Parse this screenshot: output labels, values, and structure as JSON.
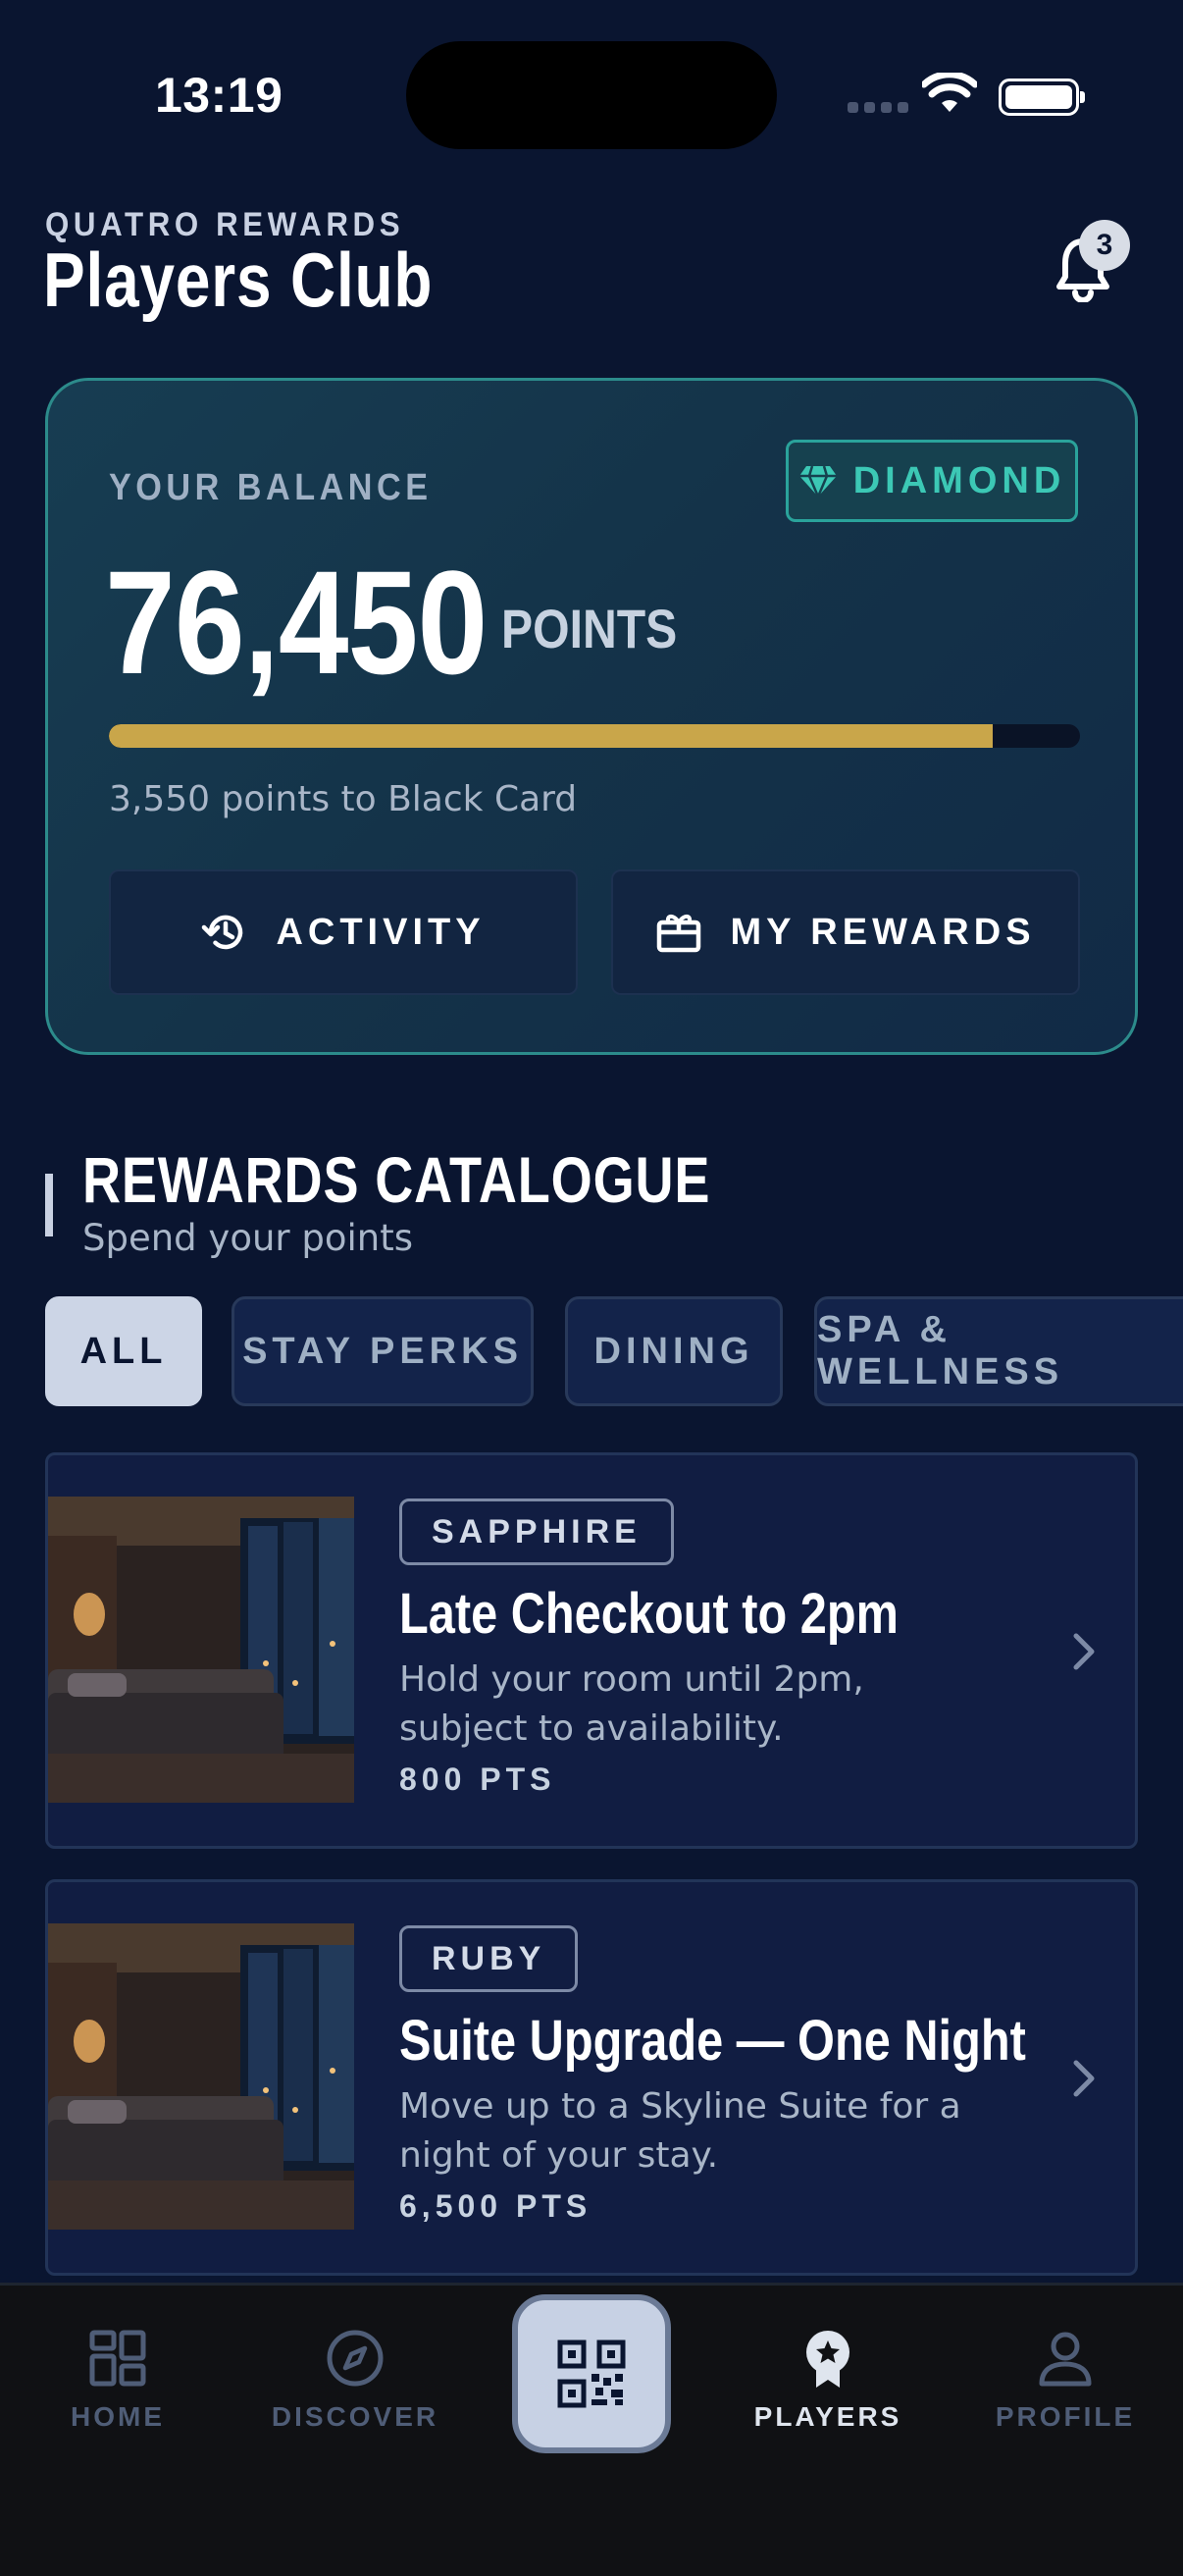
{
  "status_bar": {
    "time": "13:19"
  },
  "header": {
    "eyebrow": "QUATRO REWARDS",
    "title": "Players Club",
    "notification_count": "3"
  },
  "balance": {
    "label": "YOUR BALANCE",
    "tier": "DIAMOND",
    "points": "76,450",
    "points_unit": "POINTS",
    "progress_fraction": 0.91,
    "progress_text": "3,550 points to Black Card",
    "actions": [
      {
        "label": "ACTIVITY",
        "icon": "history-icon"
      },
      {
        "label": "MY REWARDS",
        "icon": "gift-card-icon"
      }
    ]
  },
  "catalogue": {
    "title": "REWARDS CATALOGUE",
    "subtitle": "Spend your points",
    "filters": [
      {
        "label": "ALL",
        "active": true
      },
      {
        "label": "STAY PERKS",
        "active": false
      },
      {
        "label": "DINING",
        "active": false
      },
      {
        "label": "SPA & WELLNESS",
        "active": false
      }
    ],
    "items": [
      {
        "tier": "SAPPHIRE",
        "title": "Late Checkout to 2pm",
        "description": "Hold your room until 2pm, subject to availability.",
        "points": "800 PTS"
      },
      {
        "tier": "RUBY",
        "title": "Suite Upgrade — One Night",
        "description": "Move up to a Skyline Suite for a night of your stay.",
        "points": "6,500 PTS"
      }
    ]
  },
  "tab_bar": {
    "tabs": [
      {
        "label": "HOME",
        "icon": "grid-icon",
        "active": false
      },
      {
        "label": "DISCOVER",
        "icon": "compass-icon",
        "active": false
      },
      {
        "label": "PLAYERS",
        "icon": "award-icon",
        "active": true
      },
      {
        "label": "PROFILE",
        "icon": "person-icon",
        "active": false
      }
    ],
    "center_action_icon": "qr-code-icon"
  },
  "colors": {
    "background": "#0a1530",
    "accent_teal": "#3cc8b5",
    "progress_gold": "#c9a64a"
  }
}
